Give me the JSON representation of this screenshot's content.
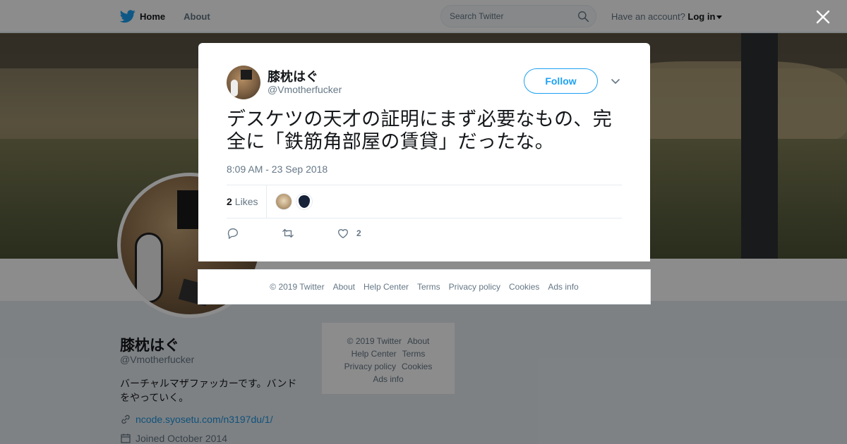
{
  "topbar": {
    "home_label": "Home",
    "about_label": "About",
    "search_placeholder": "Search Twitter",
    "account_prompt": "Have an account?",
    "login_label": "Log in"
  },
  "profile": {
    "name": "膝枕はぐ",
    "handle": "@Vmotherfucker",
    "bio": "バーチャルマザファッカーです。バンドをやっていく。",
    "link": "ncode.syosetu.com/n3197du/1/",
    "joined": "Joined October 2014"
  },
  "side_footer": {
    "copyright": "© 2019 Twitter",
    "about": "About",
    "help": "Help Center",
    "terms": "Terms",
    "privacy": "Privacy policy",
    "cookies": "Cookies",
    "ads": "Ads info"
  },
  "tweet": {
    "author_name": "膝枕はぐ",
    "author_handle": "@Vmotherfucker",
    "follow_label": "Follow",
    "text": "デスケツの天才の証明にまず必要なもの、完全に「鉄筋角部屋の賃貸」だったな。",
    "timestamp": "8:09 AM - 23 Sep 2018",
    "likes_count": "2",
    "likes_label": "Likes",
    "like_action_count": "2"
  },
  "modal_footer": {
    "copyright": "© 2019 Twitter",
    "about": "About",
    "help": "Help Center",
    "terms": "Terms",
    "privacy": "Privacy policy",
    "cookies": "Cookies",
    "ads": "Ads info"
  },
  "colors": {
    "accent": "#1da1f2",
    "overlay": "rgba(0,0,0,0.45)"
  }
}
